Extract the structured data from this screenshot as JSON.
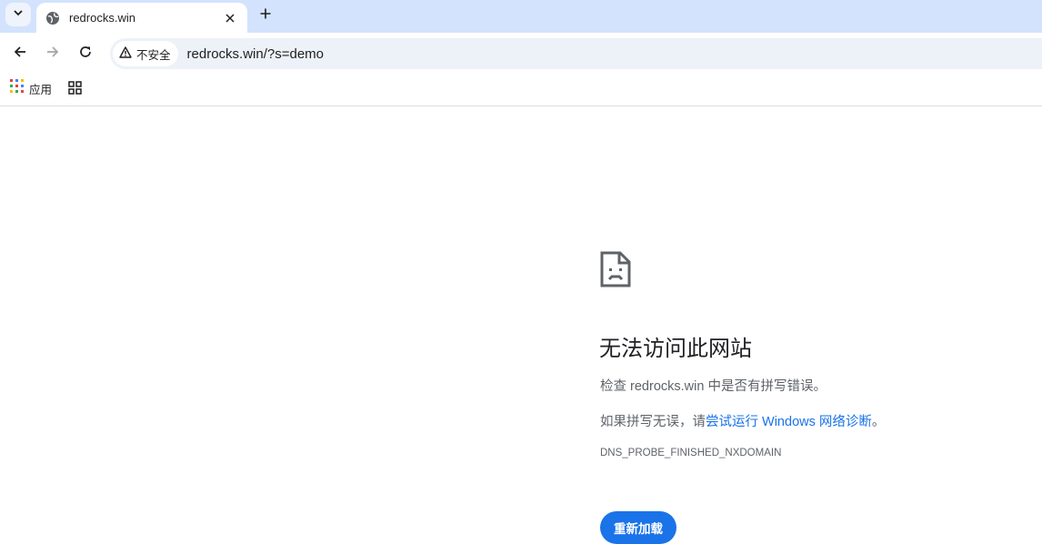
{
  "tab": {
    "title": "redrocks.win"
  },
  "toolbar": {
    "security_label": "不安全",
    "url": "redrocks.win/?s=demo"
  },
  "bookmarks": {
    "apps_label": "应用"
  },
  "error": {
    "title": "无法访问此网站",
    "line1": "检查 redrocks.win 中是否有拼写错误。",
    "line2_prefix": "如果拼写无误，请",
    "line2_link": "尝试运行 Windows 网络诊断",
    "line2_suffix": "。",
    "code": "DNS_PROBE_FINISHED_NXDOMAIN",
    "reload_label": "重新加载"
  },
  "colors": {
    "tabstrip": "#d3e3fd",
    "accent": "#1a73e8",
    "omnibox": "#edf1f8"
  }
}
